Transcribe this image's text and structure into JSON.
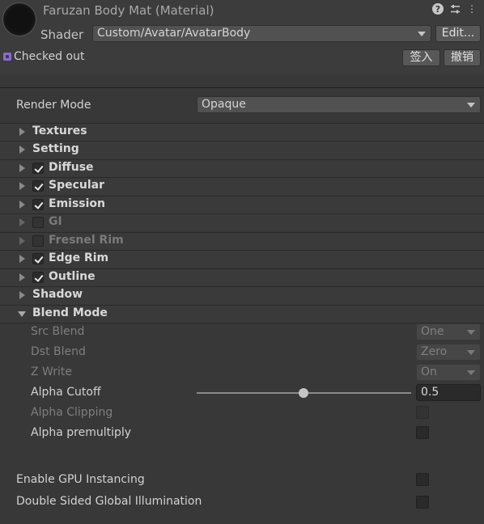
{
  "header": {
    "title": "Faruzan Body Mat (Material)",
    "shader_label": "Shader",
    "shader_value": "Custom/Avatar/AvatarBody",
    "edit_label": "Edit...",
    "status": "Checked out",
    "checkin_label": "签入",
    "revert_label": "撤销",
    "icons": [
      "help-icon",
      "presets-icon",
      "menu-icon"
    ]
  },
  "render_mode": {
    "label": "Render Mode",
    "value": "Opaque"
  },
  "foldouts": [
    {
      "label": "Textures",
      "has_checkbox": false,
      "checked": false,
      "enabled": true
    },
    {
      "label": "Setting",
      "has_checkbox": false,
      "checked": false,
      "enabled": true
    },
    {
      "label": "Diffuse",
      "has_checkbox": true,
      "checked": true,
      "enabled": true
    },
    {
      "label": "Specular",
      "has_checkbox": true,
      "checked": true,
      "enabled": true
    },
    {
      "label": "Emission",
      "has_checkbox": true,
      "checked": true,
      "enabled": true
    },
    {
      "label": "GI",
      "has_checkbox": true,
      "checked": false,
      "enabled": false
    },
    {
      "label": "Fresnel Rim",
      "has_checkbox": true,
      "checked": false,
      "enabled": false
    },
    {
      "label": "Edge Rim",
      "has_checkbox": true,
      "checked": true,
      "enabled": true
    },
    {
      "label": "Outline",
      "has_checkbox": true,
      "checked": true,
      "enabled": true
    },
    {
      "label": "Shadow",
      "has_checkbox": false,
      "checked": false,
      "enabled": true
    },
    {
      "label": "Blend Mode",
      "has_checkbox": false,
      "checked": false,
      "enabled": true,
      "expanded": true
    }
  ],
  "blend": {
    "src_label": "Src Blend",
    "src_value": "One",
    "dst_label": "Dst Blend",
    "dst_value": "Zero",
    "zwrite_label": "Z Write",
    "zwrite_value": "On",
    "cutoff_label": "Alpha Cutoff",
    "cutoff_value": "0.5",
    "clipping_label": "Alpha Clipping",
    "premultiply_label": "Alpha premultiply"
  },
  "advanced": {
    "gpu_label": "Enable GPU Instancing",
    "dsgi_label": "Double Sided Global Illumination"
  },
  "colors": {
    "background": "#383838",
    "accent_checkout": "#8c6bd6"
  }
}
